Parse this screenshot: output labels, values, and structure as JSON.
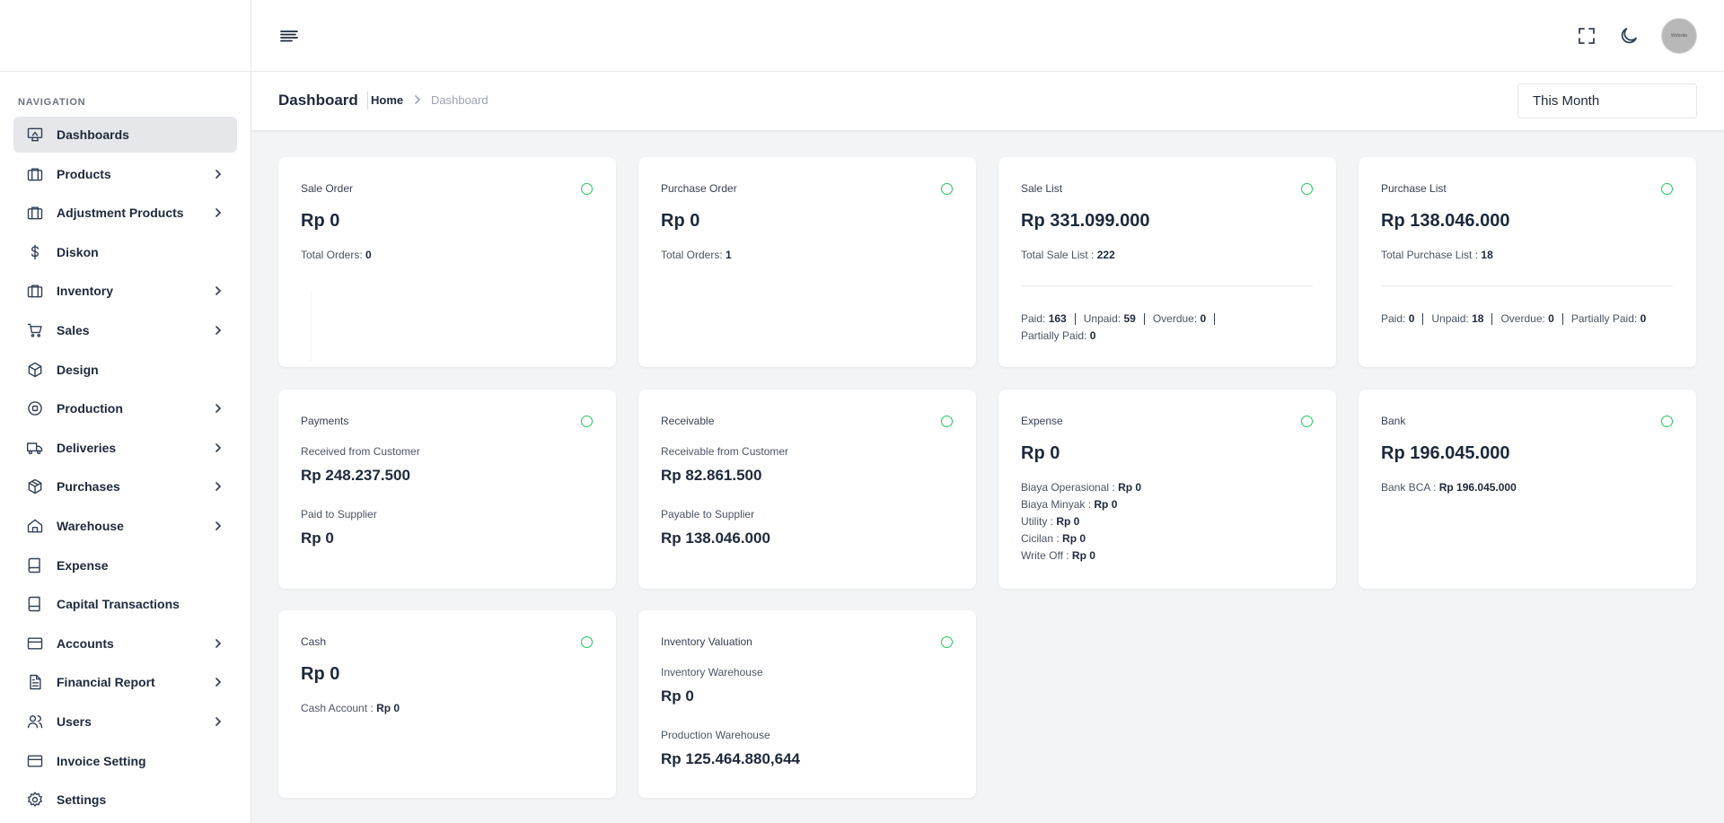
{
  "sidebar": {
    "heading": "NAVIGATION",
    "items": [
      {
        "label": "Dashboards",
        "icon": "monitor-icon",
        "chevron": false,
        "active": true
      },
      {
        "label": "Products",
        "icon": "briefcase-icon",
        "chevron": true
      },
      {
        "label": "Adjustment Products",
        "icon": "briefcase-icon",
        "chevron": true
      },
      {
        "label": "Diskon",
        "icon": "dollar-icon",
        "chevron": false
      },
      {
        "label": "Inventory",
        "icon": "briefcase-icon",
        "chevron": true
      },
      {
        "label": "Sales",
        "icon": "cart-icon",
        "chevron": true
      },
      {
        "label": "Design",
        "icon": "box-icon",
        "chevron": false
      },
      {
        "label": "Production",
        "icon": "disc-icon",
        "chevron": true
      },
      {
        "label": "Deliveries",
        "icon": "truck-icon",
        "chevron": true
      },
      {
        "label": "Purchases",
        "icon": "package-icon",
        "chevron": true
      },
      {
        "label": "Warehouse",
        "icon": "home-icon",
        "chevron": true
      },
      {
        "label": "Expense",
        "icon": "book-icon",
        "chevron": false
      },
      {
        "label": "Capital Transactions",
        "icon": "book-icon",
        "chevron": false
      },
      {
        "label": "Accounts",
        "icon": "credit-card-icon",
        "chevron": true
      },
      {
        "label": "Financial Report",
        "icon": "file-text-icon",
        "chevron": true
      },
      {
        "label": "Users",
        "icon": "users-icon",
        "chevron": true
      },
      {
        "label": "Invoice Setting",
        "icon": "credit-card-icon",
        "chevron": false
      },
      {
        "label": "Settings",
        "icon": "gear-icon",
        "chevron": false
      }
    ]
  },
  "topbar": {
    "avatar_text": "Website"
  },
  "header": {
    "title": "Dashboard",
    "breadcrumb_home": "Home",
    "breadcrumb_current": "Dashboard",
    "period": "This Month"
  },
  "cards": {
    "sale_order": {
      "title": "Sale Order",
      "amount": "Rp 0",
      "total_label": "Total Orders:",
      "total_value": "0"
    },
    "purchase_order": {
      "title": "Purchase Order",
      "amount": "Rp 0",
      "total_label": "Total Orders:",
      "total_value": "1"
    },
    "sale_list": {
      "title": "Sale List",
      "amount": "Rp 331.099.000",
      "total_label": "Total Sale List :",
      "total_value": "222",
      "paid_label": "Paid:",
      "paid": "163",
      "unpaid_label": "Unpaid:",
      "unpaid": "59",
      "overdue_label": "Overdue:",
      "overdue": "0",
      "partial_label": "Partially Paid:",
      "partial": "0"
    },
    "purchase_list": {
      "title": "Purchase List",
      "amount": "Rp 138.046.000",
      "total_label": "Total Purchase List :",
      "total_value": "18",
      "paid_label": "Paid:",
      "paid": "0",
      "unpaid_label": "Unpaid:",
      "unpaid": "18",
      "overdue_label": "Overdue:",
      "overdue": "0",
      "partial_label": "Partially Paid:",
      "partial": "0"
    },
    "payments": {
      "title": "Payments",
      "received_label": "Received from Customer",
      "received": "Rp 248.237.500",
      "paid_label": "Paid to Supplier",
      "paid": "Rp 0"
    },
    "receivable": {
      "title": "Receivable",
      "receivable_label": "Receivable from Customer",
      "receivable": "Rp 82.861.500",
      "payable_label": "Payable to Supplier",
      "payable": "Rp 138.046.000"
    },
    "expense": {
      "title": "Expense",
      "amount": "Rp 0",
      "lines": [
        {
          "label": "Biaya Operasional :",
          "value": "Rp 0"
        },
        {
          "label": "Biaya Minyak :",
          "value": "Rp 0"
        },
        {
          "label": "Utility :",
          "value": "Rp 0"
        },
        {
          "label": "Cicilan :",
          "value": "Rp 0"
        },
        {
          "label": "Write Off :",
          "value": "Rp 0"
        }
      ]
    },
    "bank": {
      "title": "Bank",
      "amount": "Rp 196.045.000",
      "line_label": "Bank BCA :",
      "line_value": "Rp 196.045.000"
    },
    "cash": {
      "title": "Cash",
      "amount": "Rp 0",
      "line_label": "Cash Account :",
      "line_value": "Rp 0"
    },
    "inventory": {
      "title": "Inventory Valuation",
      "warehouse_label": "Inventory Warehouse",
      "warehouse": "Rp 0",
      "production_label": "Production Warehouse",
      "production": "Rp 125.464.880,644"
    }
  },
  "colors": {
    "status_dot": "#22c55e",
    "active_nav": "#e5e7eb"
  }
}
